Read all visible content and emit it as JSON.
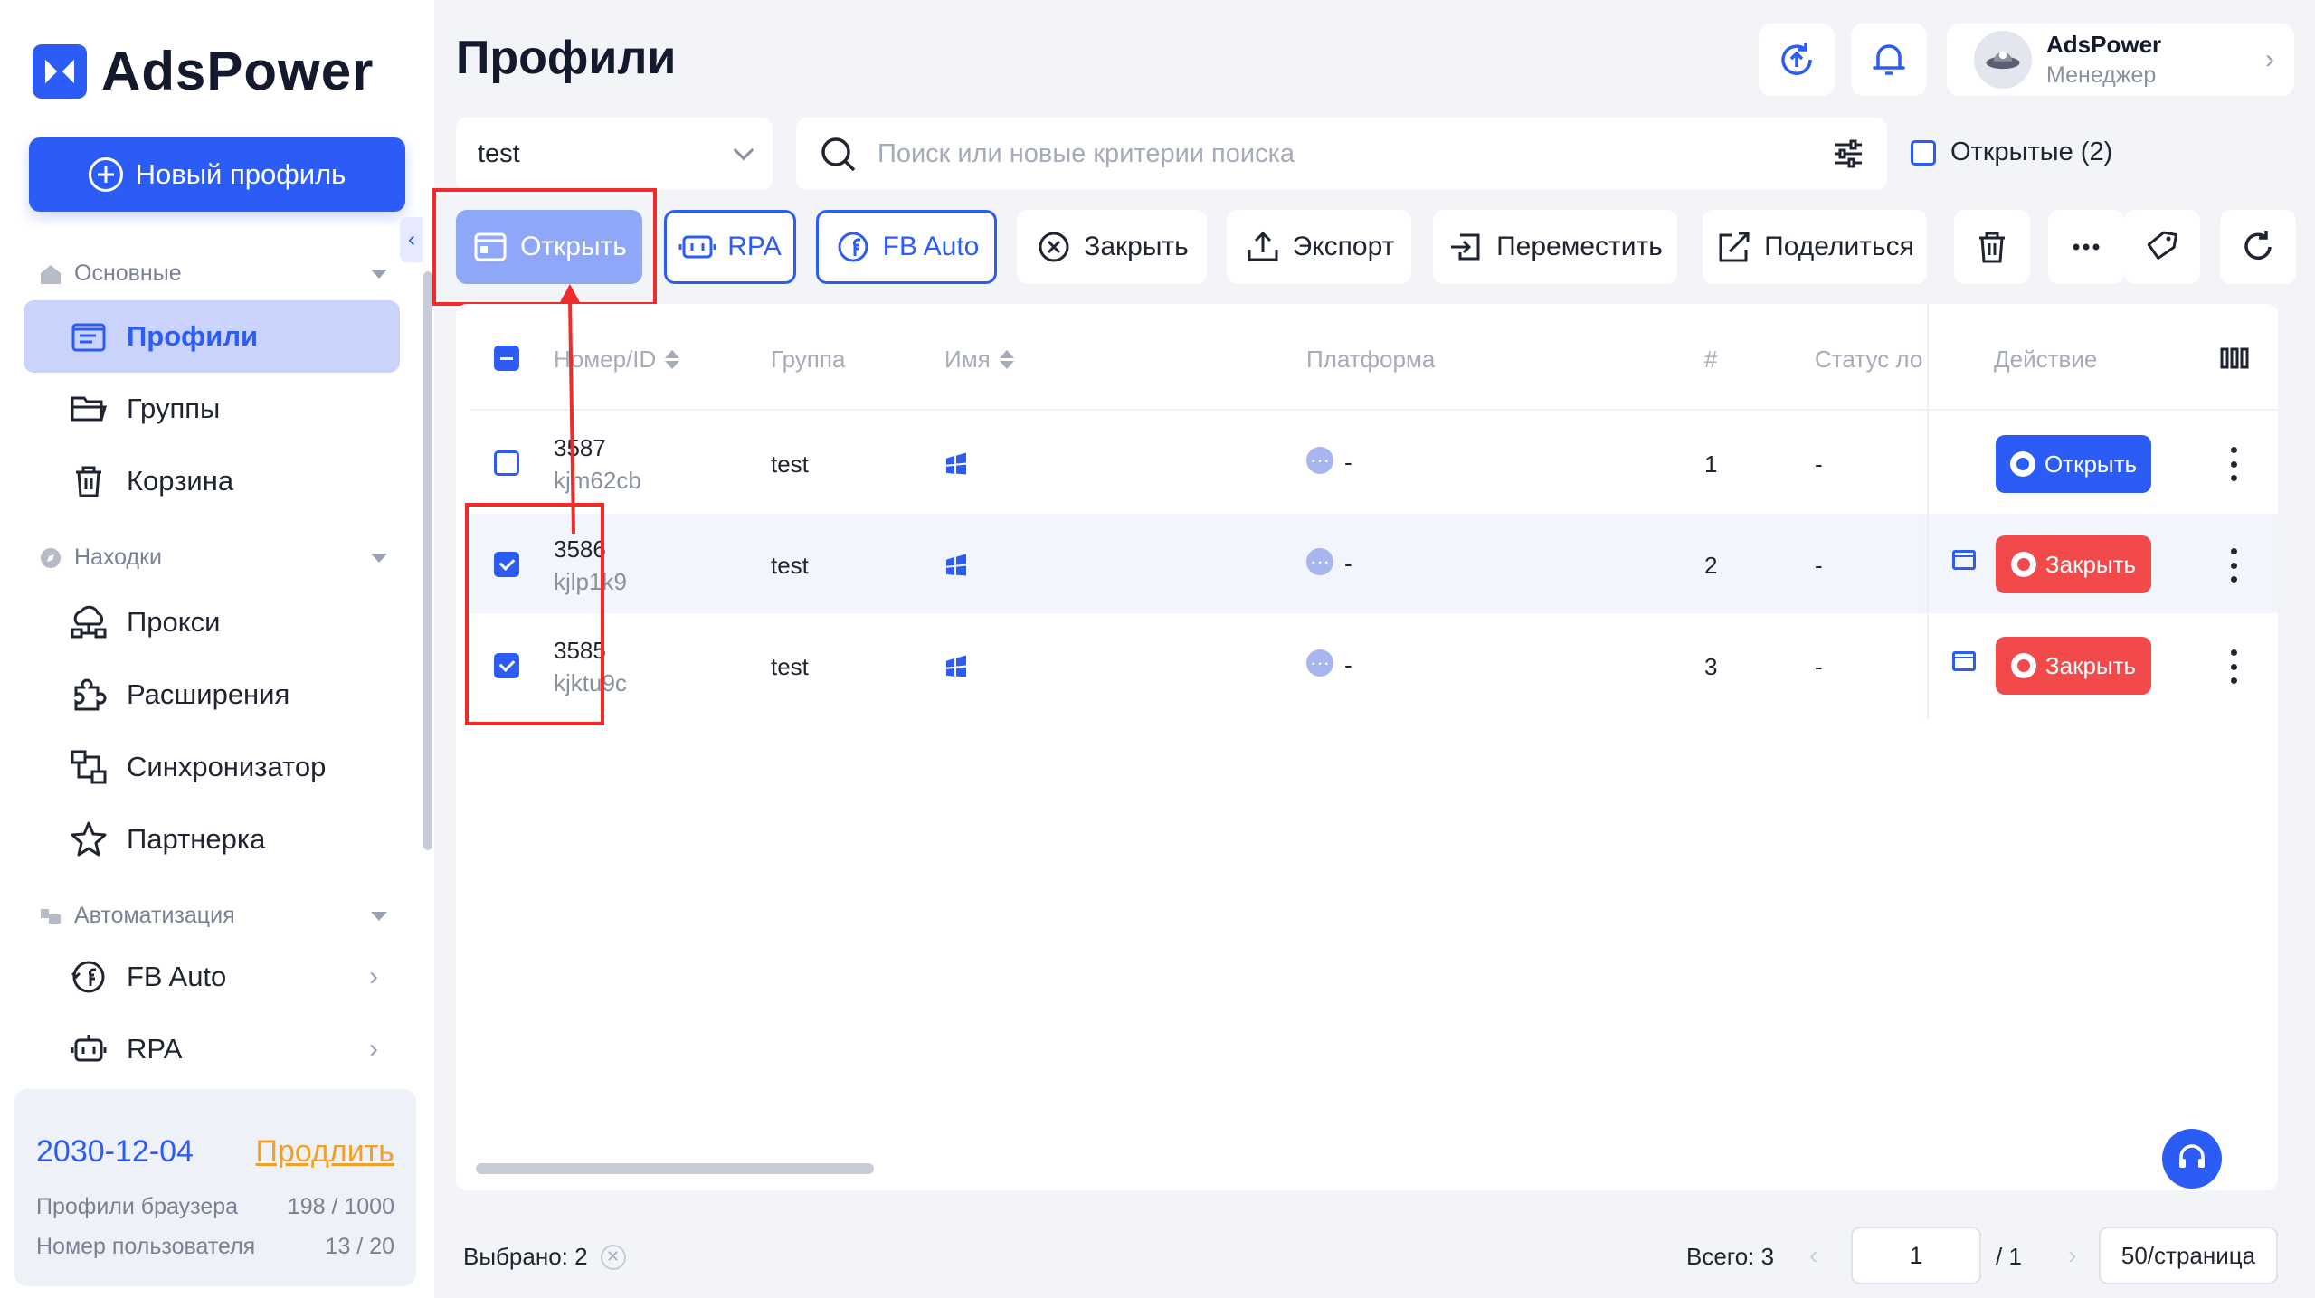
{
  "app": {
    "brand": "AdsPower"
  },
  "sidebar": {
    "new_profile": "Новый профиль",
    "sections": {
      "main": "Основные",
      "finds": "Находки",
      "automation": "Автоматизация"
    },
    "items": {
      "profiles": "Профили",
      "groups": "Группы",
      "trash": "Корзина",
      "proxy": "Прокси",
      "extensions": "Расширения",
      "sync": "Синхронизатор",
      "partner": "Партнерка",
      "fb_auto": "FB Auto",
      "rpa": "RPA"
    },
    "license": {
      "expires": "2030-12-04",
      "renew": "Продлить",
      "profiles_label": "Профили браузера",
      "profiles_value": "198 / 1000",
      "users_label": "Номер пользователя",
      "users_value": "13 / 20"
    }
  },
  "header": {
    "title": "Профили",
    "user_name": "AdsPower",
    "user_role": "Менеджер"
  },
  "filters": {
    "group": "test",
    "search_placeholder": "Поиск или новые критерии поиска",
    "opened_label": "Открытые (2)"
  },
  "toolbar": {
    "open": "Открыть",
    "rpa": "RPA",
    "fb_auto": "FB Auto",
    "close": "Закрыть",
    "export": "Экспорт",
    "move": "Переместить",
    "share": "Поделиться"
  },
  "table": {
    "columns": {
      "id": "Номер/ID",
      "group": "Группа",
      "name": "Имя",
      "platform": "Платформа",
      "num": "#",
      "status": "Статус лог",
      "action": "Действие"
    },
    "rows": [
      {
        "number": "3587",
        "id": "kjm62cb",
        "group": "test",
        "platform": "-",
        "num": "1",
        "status": "-",
        "selected": false,
        "action": "Открыть"
      },
      {
        "number": "3586",
        "id": "kjlp1k9",
        "group": "test",
        "platform": "-",
        "num": "2",
        "status": "-",
        "selected": true,
        "action": "Закрыть"
      },
      {
        "number": "3585",
        "id": "kjktu9c",
        "group": "test",
        "platform": "-",
        "num": "3",
        "status": "-",
        "selected": true,
        "action": "Закрыть"
      }
    ]
  },
  "footer": {
    "selected": "Выбрано: 2",
    "total": "Всего: 3",
    "page": "1",
    "page_of": "/ 1",
    "per_page": "50/страница"
  },
  "colors": {
    "accent": "#2c5cf6",
    "danger": "#f24a4a",
    "highlight": "#ef2b2b",
    "renew": "#f0a126"
  }
}
